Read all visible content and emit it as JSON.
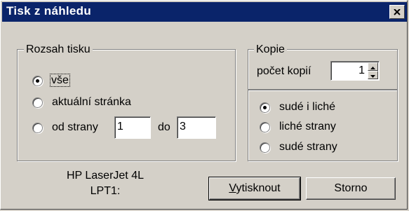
{
  "window": {
    "title": "Tisk z náhledu",
    "close_icon": "close-icon"
  },
  "print_range": {
    "legend": "Rozsah tisku",
    "options": [
      {
        "label": "vše",
        "checked": true
      },
      {
        "label": "aktuální stránka",
        "checked": false
      },
      {
        "label": "od strany",
        "checked": false
      }
    ],
    "from_value": "1",
    "to_label": "do",
    "to_value": "3"
  },
  "copies": {
    "legend": "Kopie",
    "count_label": "počet kopií",
    "count_value": "1",
    "parity_options": [
      {
        "label": "sudé i liché",
        "checked": true
      },
      {
        "label": "liché strany",
        "checked": false
      },
      {
        "label": "sudé strany",
        "checked": false
      }
    ]
  },
  "printer": {
    "name": "HP LaserJet 4L",
    "port": "LPT1:"
  },
  "buttons": {
    "print_label": "Vytisknout",
    "print_underlined_char": "V",
    "print_rest": "ytisknout",
    "cancel_label": "Storno"
  }
}
